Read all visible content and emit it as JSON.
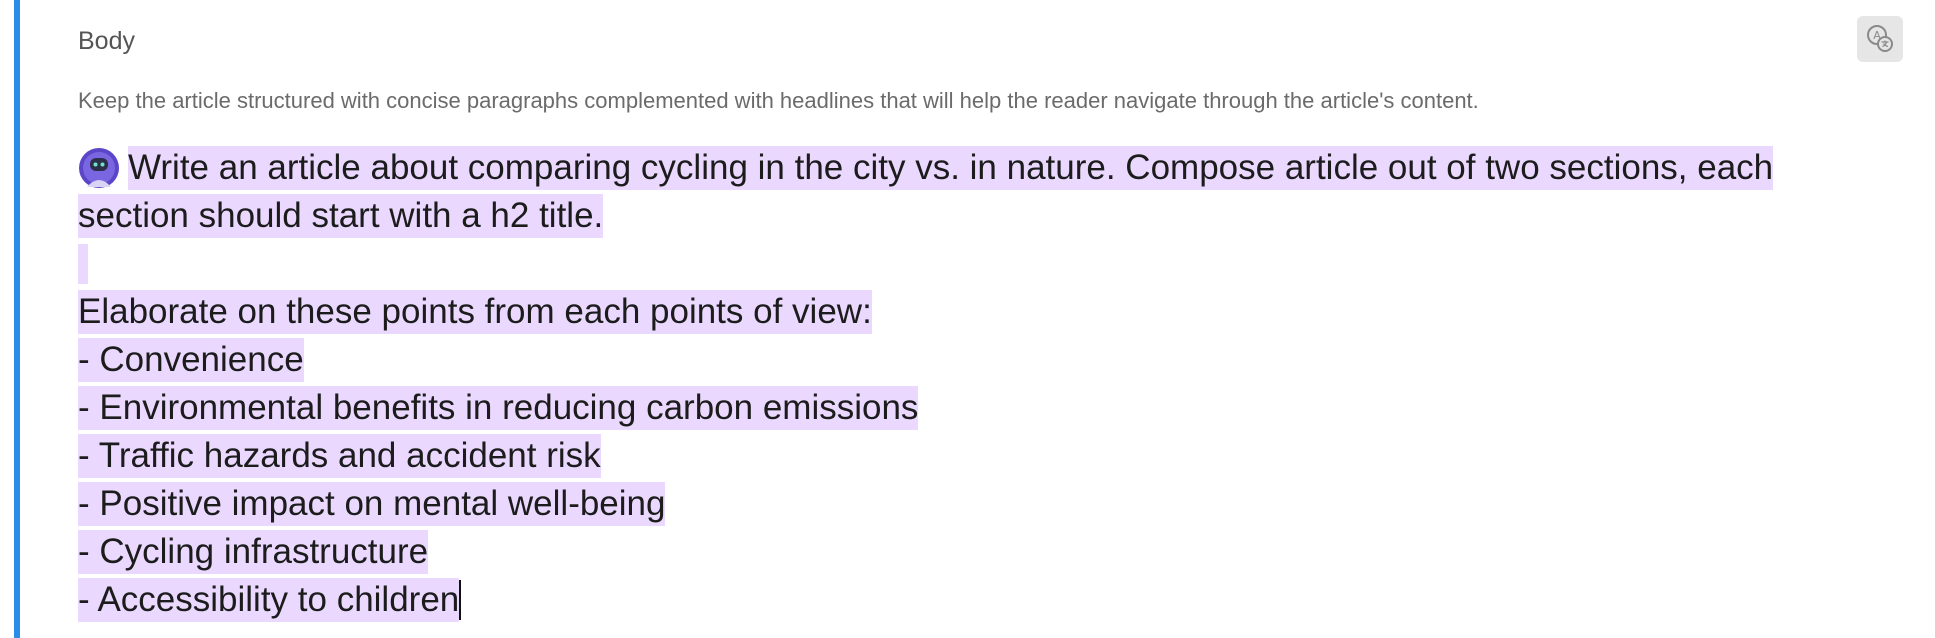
{
  "field": {
    "label": "Body",
    "help_text": "Keep the article structured with concise paragraphs complemented with headlines that will help the reader navigate through the article's content.",
    "translate_icon": "translate-icon"
  },
  "editor": {
    "ai_avatar_icon": "ai-assistant-avatar-icon",
    "highlight_color": "#ead8ff",
    "lines": [
      "Write an article about comparing cycling in the city vs. in nature. Compose article out of two sections, each",
      "section should start with a h2 title.",
      "",
      "Elaborate on these points from each points of view:",
      "- Convenience",
      "- Environmental benefits in reducing carbon emissions",
      "- Traffic hazards and accident risk",
      "- Positive impact on mental well-being",
      "- Cycling infrastructure",
      "- Accessibility to children"
    ]
  },
  "colors": {
    "focus_bar": "#2a8be8"
  }
}
